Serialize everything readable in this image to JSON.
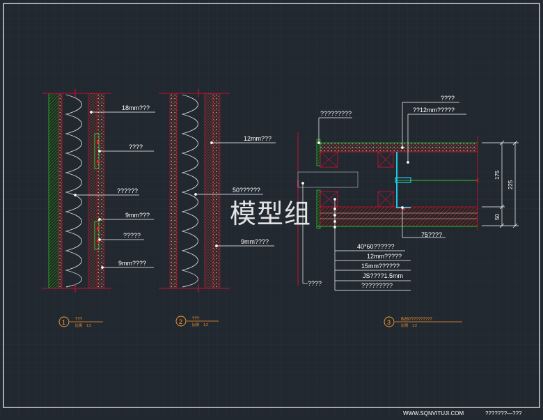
{
  "colors": {
    "background": "#212830",
    "grid": "#2a333d",
    "frame": "#ffffff",
    "wall": "#c8102e",
    "insulation": "#d8d8d8",
    "green": "#2fbf2f",
    "cyan": "#23c7e6",
    "hatch": "#c0392b",
    "annotation": "#ffffff",
    "detail_label": "#ff9a2e"
  },
  "watermark": "模型组",
  "footer": {
    "website": "WWW.SQNVITUJI.COM",
    "sheet_title": "???????—???"
  },
  "detail1": {
    "labels": [
      "18mm???",
      "????",
      "??????",
      "9mm???",
      "?????",
      "9mm????"
    ],
    "number": "1",
    "title": "???",
    "scale_label": "比例",
    "scale": "1:2"
  },
  "detail2": {
    "labels": [
      "12mm???",
      "50??????",
      "9mm????"
    ],
    "number": "2",
    "title": "???",
    "scale_label": "比例",
    "scale": "1:2"
  },
  "detail3": {
    "labels": [
      "????",
      "??12mm?????",
      "?????????",
      "75????",
      "40*60??????",
      "12mm?????",
      "15mm??????",
      "JS????1.5mm",
      "?????????",
      "????"
    ],
    "dimensions": [
      "175",
      "225",
      "50"
    ],
    "number": "3",
    "title": "B2B??????????",
    "scale_label": "比例",
    "scale": "1:2"
  }
}
